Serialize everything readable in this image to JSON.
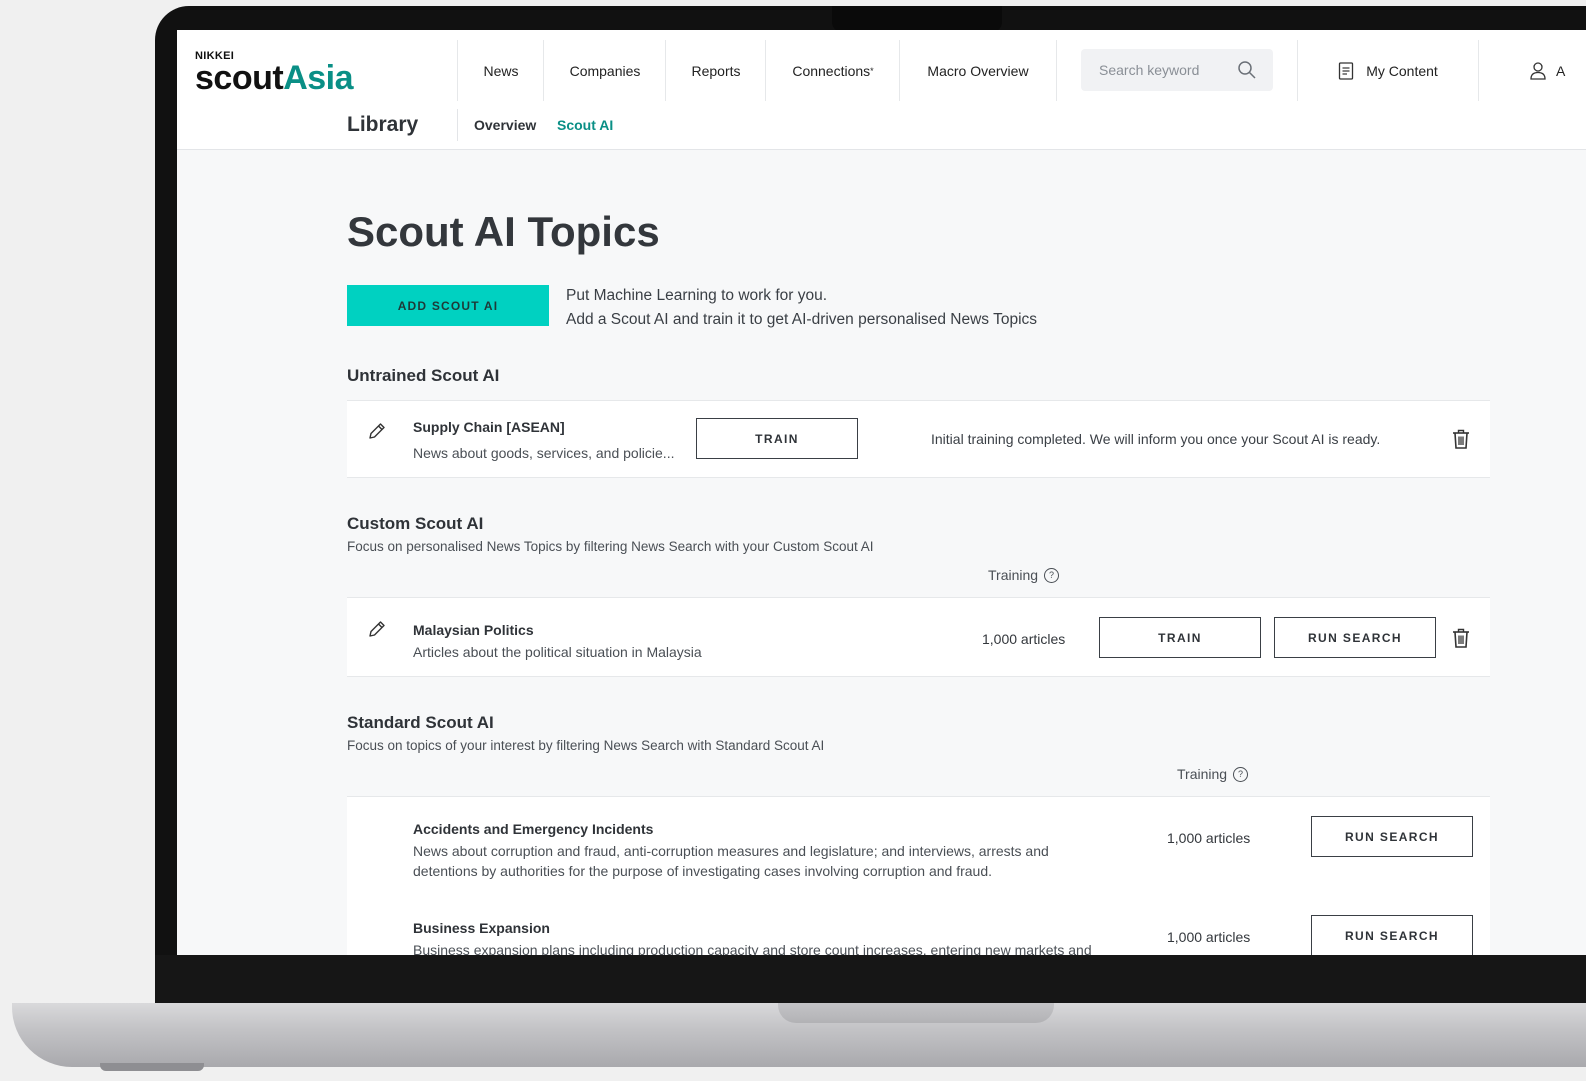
{
  "header": {
    "logo_small": "NIKKEI",
    "logo_scout": "scout",
    "logo_asia": "Asia",
    "nav": [
      "News",
      "Companies",
      "Reports",
      "Connections",
      "Macro Overview"
    ],
    "connections_mark": "*",
    "search_placeholder": "Search keyword",
    "my_content": "My Content",
    "account_label": "A"
  },
  "subnav": {
    "title": "Library",
    "links": [
      "Overview",
      "Scout AI"
    ],
    "active": "Scout AI"
  },
  "page": {
    "title": "Scout AI Topics",
    "add_button": "ADD SCOUT AI",
    "intro_line1": "Put Machine Learning to work for you.",
    "intro_line2": "Add a Scout AI and train it to get AI-driven personalised News Topics"
  },
  "untrained": {
    "heading": "Untrained Scout AI",
    "items": [
      {
        "title": "Supply Chain [ASEAN]",
        "description": "News about goods, services, and policie...",
        "train_label": "TRAIN",
        "status": "Initial training completed. We will inform you once your Scout AI is ready."
      }
    ]
  },
  "custom": {
    "heading": "Custom Scout AI",
    "description": "Focus on personalised News Topics by filtering News Search with your Custom Scout AI",
    "training_label": "Training",
    "items": [
      {
        "title": "Malaysian Politics",
        "description": "Articles about the political situation in Malaysia",
        "count": "1,000 articles",
        "train_label": "TRAIN",
        "run_label": "RUN SEARCH"
      }
    ]
  },
  "standard": {
    "heading": "Standard Scout AI",
    "description": "Focus on topics of your interest by filtering News Search with Standard Scout AI",
    "training_label": "Training",
    "items": [
      {
        "title": "Accidents and Emergency Incidents",
        "description_line1": "News about corruption and fraud, anti-corruption measures and legislature; and interviews, arrests and",
        "description_line2": "detentions by authorities for the purpose of investigating cases involving corruption and fraud.",
        "count": "1,000 articles",
        "run_label": "RUN SEARCH"
      },
      {
        "title": "Business Expansion",
        "description_line1": "Business expansion plans including production capacity and store count increases, entering new markets and",
        "count": "1,000 articles",
        "run_label": "RUN SEARCH"
      }
    ]
  },
  "colors": {
    "brand_teal": "#0a8f86",
    "accent_cyan": "#00d1c1",
    "text_dark": "#2f3338"
  },
  "icons": [
    "search-icon",
    "document-icon",
    "user-icon",
    "pencil-icon",
    "trash-icon",
    "help-icon"
  ]
}
